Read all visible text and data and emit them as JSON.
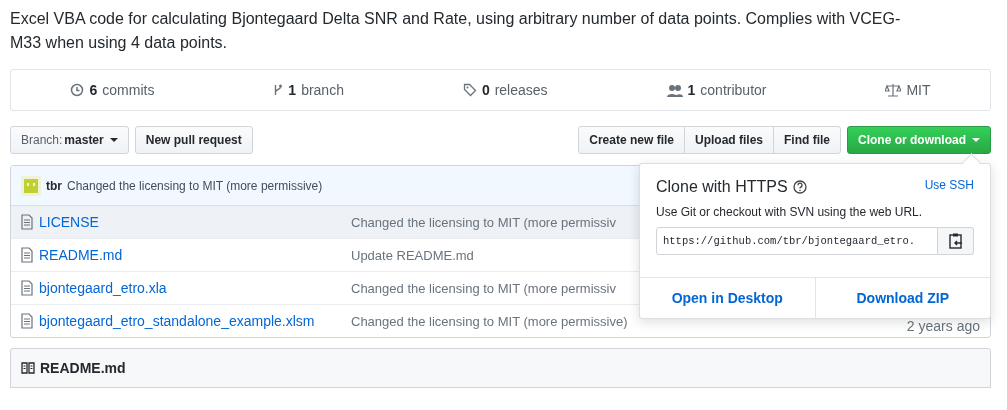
{
  "description": "Excel VBA code for calculating Bjontegaard Delta SNR and Rate, using arbitrary number of data points. Complies with VCEG-M33 when using 4 data points.",
  "stats": [
    {
      "kind": "commits",
      "count": "6",
      "label": "commits"
    },
    {
      "kind": "branch",
      "count": "1",
      "label": "branch"
    },
    {
      "kind": "releases",
      "count": "0",
      "label": "releases"
    },
    {
      "kind": "contributors",
      "count": "1",
      "label": "contributor"
    },
    {
      "kind": "license",
      "label": "MIT"
    }
  ],
  "toolbar": {
    "branch_label": "Branch:",
    "branch": "master",
    "new_pull_request": "New pull request",
    "buttons": [
      "Create new file",
      "Upload files",
      "Find file"
    ],
    "clone": "Clone or download"
  },
  "commit": {
    "author": "tbr",
    "message": "Changed the licensing to MIT (more permissive)"
  },
  "files": [
    {
      "name": "LICENSE",
      "message": "Changed the licensing to MIT (more permissiv",
      "hovered": true
    },
    {
      "name": "README.md",
      "message": "Update README.md",
      "hovered": false
    },
    {
      "name": "bjontegaard_etro.xla",
      "message": "Changed the licensing to MIT (more permissiv",
      "hovered": false
    },
    {
      "name": "bjontegaard_etro_standalone_example.xlsm",
      "message": "Changed the licensing to MIT (more permissive)",
      "age": "2 years ago",
      "hovered": false
    }
  ],
  "clone_popup": {
    "title": "Clone with HTTPS",
    "switch": "Use SSH",
    "hint": "Use Git or checkout with SVN using the web URL.",
    "url": "https://github.com/tbr/bjontegaard_etro.",
    "actions": [
      "Open in Desktop",
      "Download ZIP"
    ]
  },
  "readme": {
    "title": "README.md"
  }
}
